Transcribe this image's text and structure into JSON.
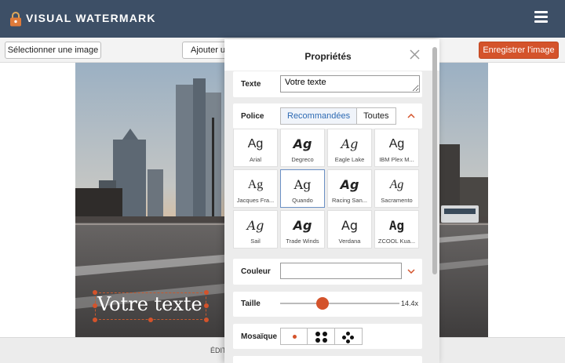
{
  "app": {
    "title": "VISUAL WATERMARK"
  },
  "toolbar": {
    "select_image": "Sélectionner une image",
    "add": "Ajouter un",
    "save": "Enregistrer l'image"
  },
  "canvas": {
    "watermark_text": "Votre texte"
  },
  "bottombar": {
    "label": "ÉDITI"
  },
  "panel": {
    "title": "Propriétés",
    "text": {
      "label": "Texte",
      "value": "Votre texte"
    },
    "font": {
      "label": "Police",
      "tabs": [
        "Recommandées",
        "Toutes"
      ],
      "active_tab": "Recommandées",
      "fonts": [
        {
          "glyph": "Ag",
          "name": "Arial"
        },
        {
          "glyph": "Ag",
          "name": "Degreco"
        },
        {
          "glyph": "Ag",
          "name": "Eagle Lake"
        },
        {
          "glyph": "Ag",
          "name": "IBM Plex M..."
        },
        {
          "glyph": "Ag",
          "name": "Jacques Fra..."
        },
        {
          "glyph": "Ag",
          "name": "Quando"
        },
        {
          "glyph": "Ag",
          "name": "Racing San..."
        },
        {
          "glyph": "Ag",
          "name": "Sacramento"
        },
        {
          "glyph": "Ag",
          "name": "Sail"
        },
        {
          "glyph": "Ag",
          "name": "Trade Winds"
        },
        {
          "glyph": "Ag",
          "name": "Verdana"
        },
        {
          "glyph": "Ag",
          "name": "ZCOOL Kua..."
        }
      ],
      "selected_font": "Quando"
    },
    "color": {
      "label": "Couleur"
    },
    "size": {
      "label": "Taille",
      "value": "14.4x"
    },
    "mosaic": {
      "label": "Mosaïque",
      "options": [
        "single",
        "four",
        "five"
      ]
    }
  },
  "colors": {
    "topbar": "#3d4f66",
    "accent": "#d4532b",
    "selected_border": "#6b90c4",
    "tab_active": "#2d6ab3"
  }
}
